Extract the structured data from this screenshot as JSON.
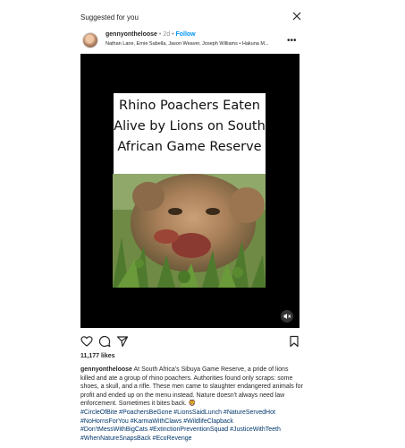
{
  "header": {
    "suggested_label": "Suggested for you"
  },
  "post": {
    "username": "gennyontheloose",
    "separator": "•",
    "age": "2d",
    "follow_label": "Follow",
    "music": "Nathan Lane, Ernie Sabella, Jason Weaver, Joseph Williams • Hakuna M...",
    "more_label": "•••",
    "media_title": "Rhino Poachers Eaten Alive by Lions on South African Game Reserve",
    "likes": "11,177 likes",
    "caption_user": "gennyontheloose",
    "caption_text": "At South Africa's Sibuya Game Reserve, a pride of lions killed and ate a group of rhino poachers. Authorities found only scraps: some shoes, a skull, and a rifle. These men came to slaughter endangered animals for profit and ended up on the menu instead. Nature doesn't always need law enforcement. Sometimes it bites back. 🦁",
    "hashtags_line1": "#CircleOfBite #PoachersBeGone #LionsSaidLunch #NatureServedHot",
    "hashtags_line2": "#NoHornsForYou #KarmaWithClaws #WildlifeClapback",
    "hashtags_line3": "#Don'tMessWithBigCats #ExtinctionPreventionSquad #JusticeWithTeeth",
    "hashtags_line4": "#WhenNatureSnapsBack #EcoRevenge"
  },
  "icons": {
    "close": "close-icon",
    "like": "heart-icon",
    "comment": "comment-icon",
    "share": "send-icon",
    "save": "bookmark-icon",
    "mute": "speaker-muted-icon",
    "more": "more-horizontal-icon"
  }
}
